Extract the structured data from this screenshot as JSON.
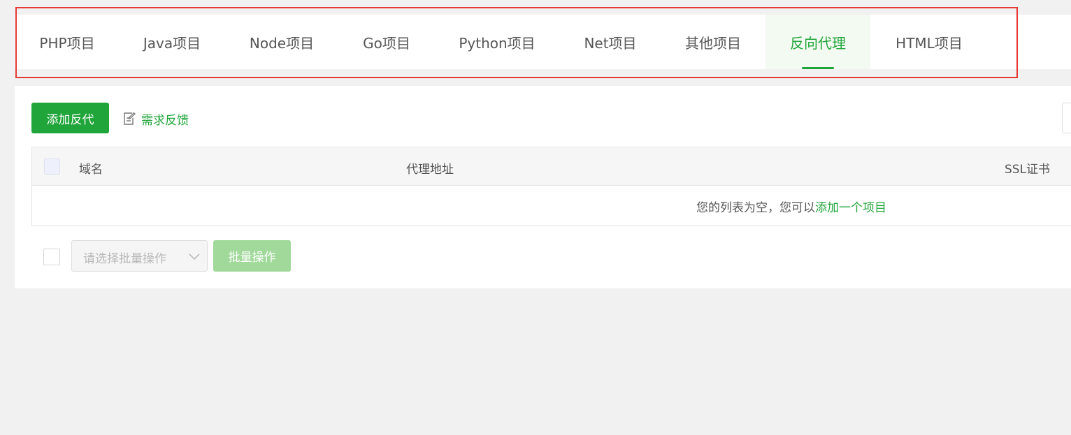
{
  "tabs": [
    {
      "label": "PHP项目",
      "active": false
    },
    {
      "label": "Java项目",
      "active": false
    },
    {
      "label": "Node项目",
      "active": false
    },
    {
      "label": "Go项目",
      "active": false
    },
    {
      "label": "Python项目",
      "active": false
    },
    {
      "label": "Net项目",
      "active": false
    },
    {
      "label": "其他项目",
      "active": false
    },
    {
      "label": "反向代理",
      "active": true
    },
    {
      "label": "HTML项目",
      "active": false
    }
  ],
  "toolbar": {
    "add_label": "添加反代",
    "feedback_label": "需求反馈",
    "feedback_icon": "edit-note-icon"
  },
  "table": {
    "columns": [
      "域名",
      "代理地址",
      "SSL证书"
    ],
    "empty_prefix": "您的列表为空，您可以",
    "empty_link": "添加一个项目"
  },
  "footer": {
    "batch_placeholder": "请选择批量操作",
    "batch_button": "批量操作",
    "chevron_icon": "chevron-down-icon"
  },
  "colors": {
    "accent": "#20a53a",
    "highlight_border": "#e53935",
    "active_tab_bg": "#f3faf1"
  }
}
